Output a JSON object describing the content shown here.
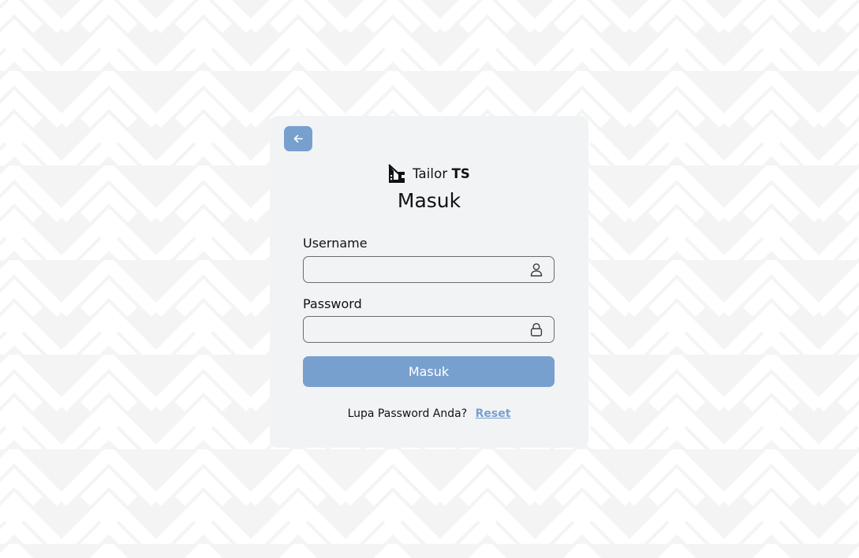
{
  "page": {
    "background_color": "#f4f4f5",
    "pattern_color": "#ffffff",
    "accent_color": "#77a0cf"
  },
  "nav": {
    "back_icon": "arrow-left-icon"
  },
  "brand": {
    "name": "Tailor",
    "suffix": "TS",
    "logo_icon": "tailor-ruler-logo-icon"
  },
  "form": {
    "title": "Masuk",
    "username": {
      "label": "Username",
      "value": "",
      "placeholder": "",
      "icon": "user-icon"
    },
    "password": {
      "label": "Password",
      "value": "",
      "placeholder": "",
      "icon": "lock-icon"
    },
    "submit_label": "Masuk",
    "forgot_text": "Lupa Password Anda?",
    "reset_label": "Reset"
  }
}
